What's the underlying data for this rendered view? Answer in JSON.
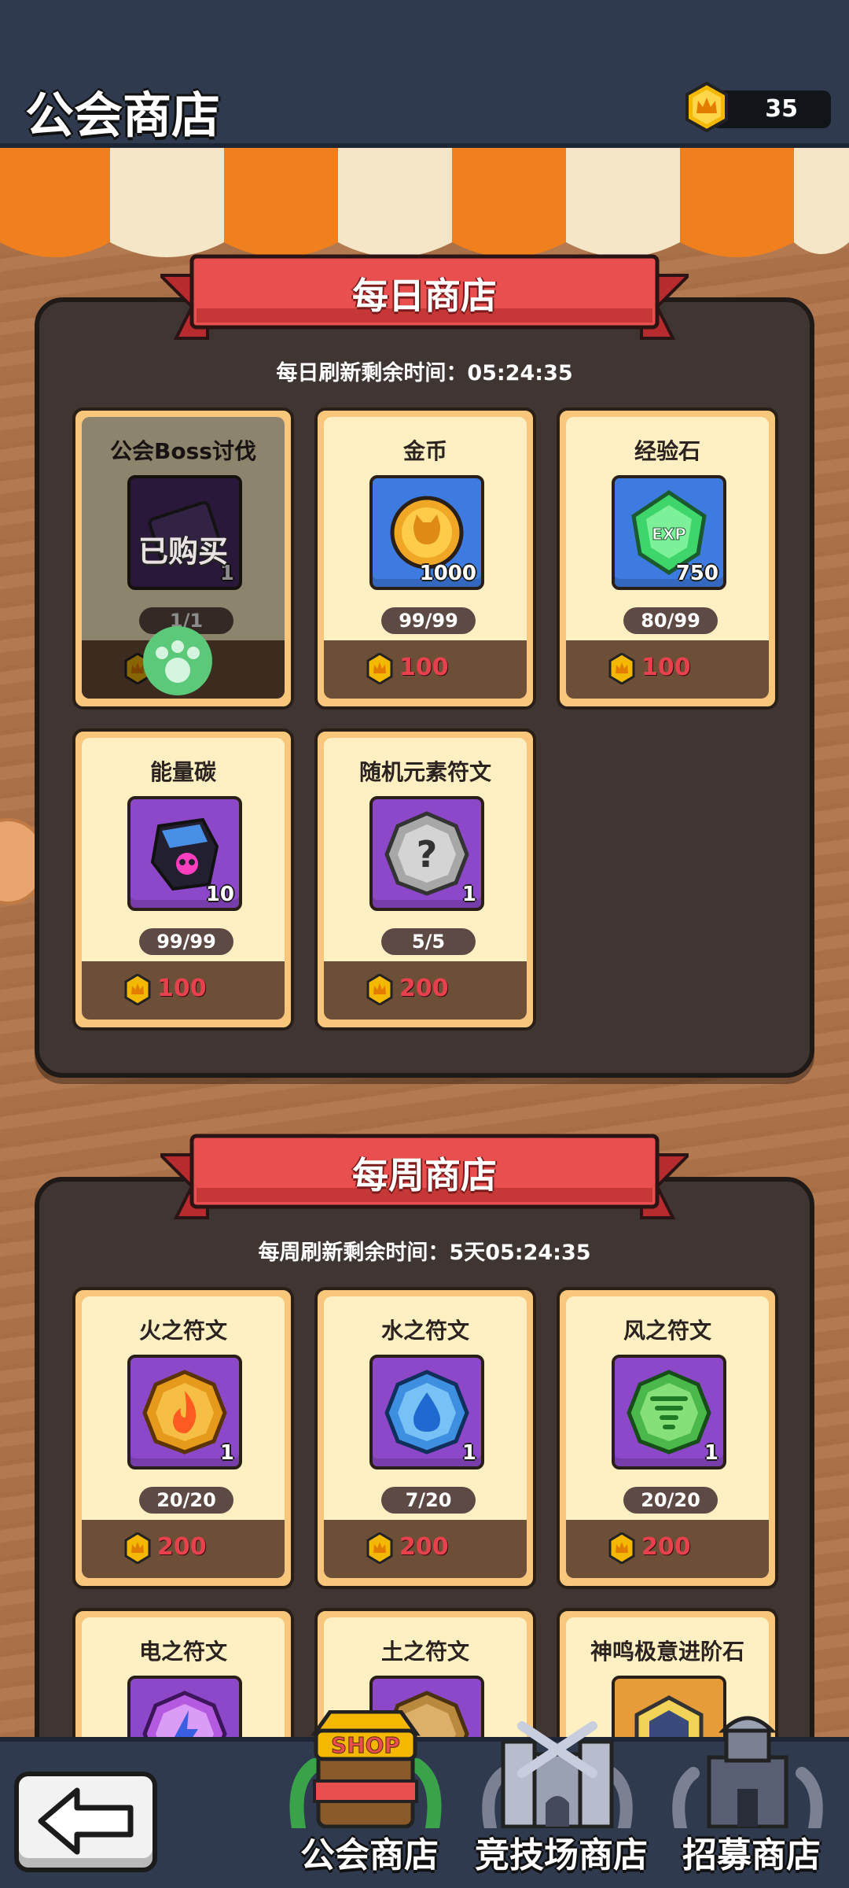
{
  "header": {
    "title": "公会商店",
    "currency_value": "35"
  },
  "daily_shop": {
    "title": "每日商店",
    "timer": "每日刷新剩余时间：05:24:35",
    "items": [
      {
        "name": "公会Boss讨伐",
        "qty": "1",
        "stock": "1/1",
        "price": "100",
        "icon": "boss-ticket-icon",
        "purchased": true,
        "purchased_label": "已购买"
      },
      {
        "name": "金币",
        "qty": "1000",
        "stock": "99/99",
        "price": "100",
        "icon": "gold-coin-icon"
      },
      {
        "name": "经验石",
        "qty": "750",
        "stock": "80/99",
        "price": "100",
        "icon": "exp-gem-icon"
      },
      {
        "name": "能量碳",
        "qty": "10",
        "stock": "99/99",
        "price": "100",
        "icon": "energy-carbon-icon"
      },
      {
        "name": "随机元素符文",
        "qty": "1",
        "stock": "5/5",
        "price": "200",
        "icon": "random-rune-icon"
      }
    ]
  },
  "weekly_shop": {
    "title": "每周商店",
    "timer": "每周刷新剩余时间：5天05:24:35",
    "items": [
      {
        "name": "火之符文",
        "qty": "1",
        "stock": "20/20",
        "price": "200",
        "icon": "fire-rune-icon"
      },
      {
        "name": "水之符文",
        "qty": "1",
        "stock": "7/20",
        "price": "200",
        "icon": "water-rune-icon"
      },
      {
        "name": "风之符文",
        "qty": "1",
        "stock": "20/20",
        "price": "200",
        "icon": "wind-rune-icon"
      },
      {
        "name": "电之符文",
        "icon": "thunder-rune-icon"
      },
      {
        "name": "土之符文",
        "icon": "earth-rune-icon"
      },
      {
        "name": "神鸣极意进阶石",
        "icon": "advance-stone-icon"
      }
    ]
  },
  "bottom_nav": {
    "tabs": [
      {
        "label": "公会商店",
        "icon": "shop-icon",
        "active": true
      },
      {
        "label": "竞技场商店",
        "icon": "arena-castle-icon"
      },
      {
        "label": "招募商店",
        "icon": "recruit-tower-icon"
      }
    ],
    "shop_badge": "SHOP"
  },
  "colors": {
    "header_bg": "#2f3a4f",
    "price_red": "#e8414e",
    "card_bg": "#fff0c4",
    "panel_bg": "#3f3533"
  }
}
